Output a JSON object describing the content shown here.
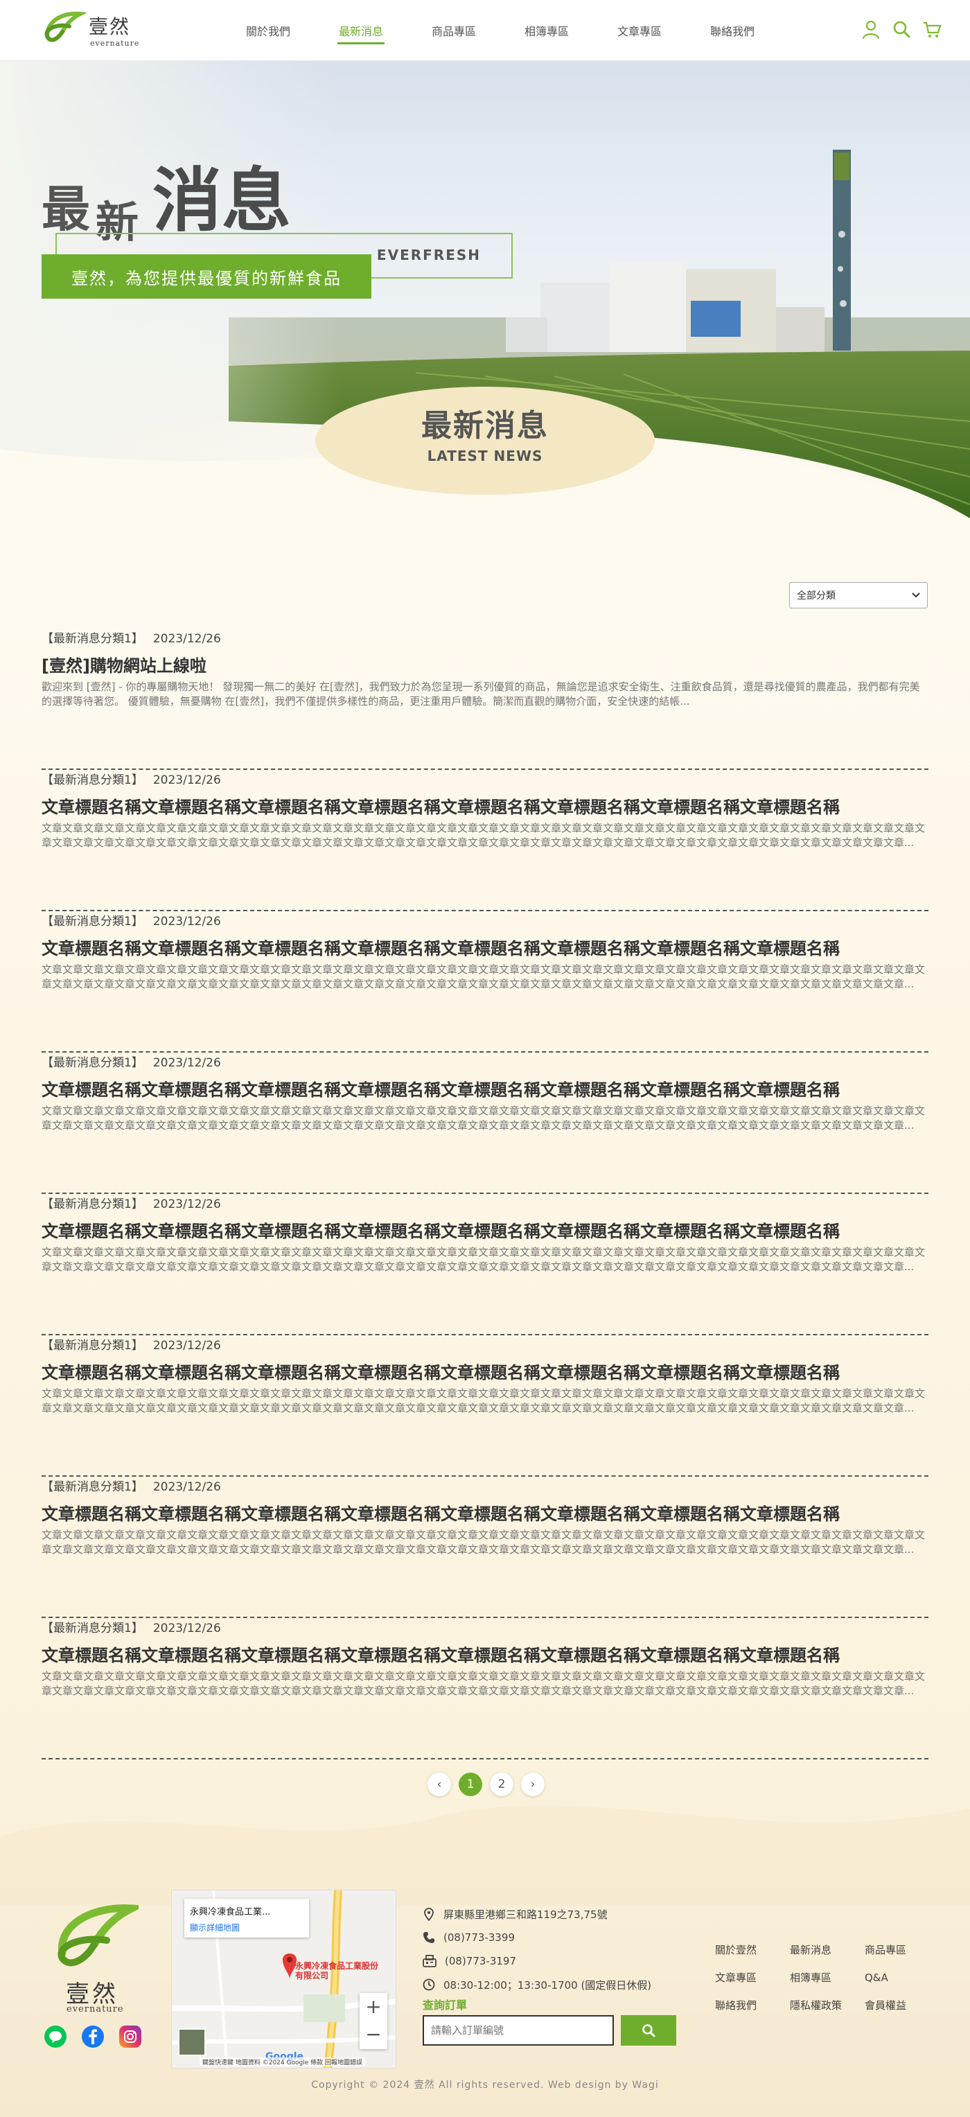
{
  "header": {
    "logo_name": "壹然",
    "logo_sub": "evernature",
    "nav": [
      {
        "label": "關於我們",
        "active": false
      },
      {
        "label": "最新消息",
        "active": true
      },
      {
        "label": "商品專區",
        "active": false
      },
      {
        "label": "相簿專區",
        "active": false
      },
      {
        "label": "文章專區",
        "active": false
      },
      {
        "label": "聯絡我們",
        "active": false
      }
    ],
    "icons": [
      "user-icon",
      "search-icon",
      "cart-icon"
    ]
  },
  "hero": {
    "title_a": "最",
    "title_b": "新",
    "title_c": "消息",
    "box_label": "EVERFRESH",
    "tagline": "壹然，為您提供最優質的新鮮食品",
    "badge_title": "最新消息",
    "badge_sub": "LATEST NEWS"
  },
  "filter": {
    "selected": "全部分類"
  },
  "news": [
    {
      "category": "【最新消息分類1】",
      "date": "2023/12/26",
      "title": "[壹然]購物網站上線啦",
      "desc": "歡迎來到 [壹然] - 你的專屬購物天地！ 發現獨一無二的美好 在[壹然]，我們致力於為您呈現一系列優質的商品，無論您是追求安全衛生、注重飲食品質，還是尋找優質的農產品，我們都有完美的選擇等待著您。 優質體驗，無憂購物 在[壹然]，我們不僅提供多樣性的商品，更注重用戶體驗。簡潔而直觀的購物介面，安全快速的結帳..."
    },
    {
      "category": "【最新消息分類1】",
      "date": "2023/12/26",
      "title": "文章標題名稱文章標題名稱文章標題名稱文章標題名稱文章標題名稱文章標題名稱文章標題名稱文章標題名稱",
      "desc": "文章文章文章文章文章文章文章文章文章文章文章文章文章文章文章文章文章文章文章文章文章文章文章文章文章文章文章文章文章文章文章文章文章文章文章文章文章文章文章文章文章文章文章文章文章文章文章文章文章文章文章文章文章文章文章文章文章文章文章文章文章文章文章文章文章文章文章文章文章文章文章文章文章文章文章文章文章文章文章文章文章文章文章文章..."
    },
    {
      "category": "【最新消息分類1】",
      "date": "2023/12/26",
      "title": "文章標題名稱文章標題名稱文章標題名稱文章標題名稱文章標題名稱文章標題名稱文章標題名稱文章標題名稱",
      "desc": "文章文章文章文章文章文章文章文章文章文章文章文章文章文章文章文章文章文章文章文章文章文章文章文章文章文章文章文章文章文章文章文章文章文章文章文章文章文章文章文章文章文章文章文章文章文章文章文章文章文章文章文章文章文章文章文章文章文章文章文章文章文章文章文章文章文章文章文章文章文章文章文章文章文章文章文章文章文章文章文章文章文章文章文章..."
    },
    {
      "category": "【最新消息分類1】",
      "date": "2023/12/26",
      "title": "文章標題名稱文章標題名稱文章標題名稱文章標題名稱文章標題名稱文章標題名稱文章標題名稱文章標題名稱",
      "desc": "文章文章文章文章文章文章文章文章文章文章文章文章文章文章文章文章文章文章文章文章文章文章文章文章文章文章文章文章文章文章文章文章文章文章文章文章文章文章文章文章文章文章文章文章文章文章文章文章文章文章文章文章文章文章文章文章文章文章文章文章文章文章文章文章文章文章文章文章文章文章文章文章文章文章文章文章文章文章文章文章文章文章文章文章..."
    },
    {
      "category": "【最新消息分類1】",
      "date": "2023/12/26",
      "title": "文章標題名稱文章標題名稱文章標題名稱文章標題名稱文章標題名稱文章標題名稱文章標題名稱文章標題名稱",
      "desc": "文章文章文章文章文章文章文章文章文章文章文章文章文章文章文章文章文章文章文章文章文章文章文章文章文章文章文章文章文章文章文章文章文章文章文章文章文章文章文章文章文章文章文章文章文章文章文章文章文章文章文章文章文章文章文章文章文章文章文章文章文章文章文章文章文章文章文章文章文章文章文章文章文章文章文章文章文章文章文章文章文章文章文章文章..."
    },
    {
      "category": "【最新消息分類1】",
      "date": "2023/12/26",
      "title": "文章標題名稱文章標題名稱文章標題名稱文章標題名稱文章標題名稱文章標題名稱文章標題名稱文章標題名稱",
      "desc": "文章文章文章文章文章文章文章文章文章文章文章文章文章文章文章文章文章文章文章文章文章文章文章文章文章文章文章文章文章文章文章文章文章文章文章文章文章文章文章文章文章文章文章文章文章文章文章文章文章文章文章文章文章文章文章文章文章文章文章文章文章文章文章文章文章文章文章文章文章文章文章文章文章文章文章文章文章文章文章文章文章文章文章文章..."
    },
    {
      "category": "【最新消息分類1】",
      "date": "2023/12/26",
      "title": "文章標題名稱文章標題名稱文章標題名稱文章標題名稱文章標題名稱文章標題名稱文章標題名稱文章標題名稱",
      "desc": "文章文章文章文章文章文章文章文章文章文章文章文章文章文章文章文章文章文章文章文章文章文章文章文章文章文章文章文章文章文章文章文章文章文章文章文章文章文章文章文章文章文章文章文章文章文章文章文章文章文章文章文章文章文章文章文章文章文章文章文章文章文章文章文章文章文章文章文章文章文章文章文章文章文章文章文章文章文章文章文章文章文章文章文章..."
    },
    {
      "category": "【最新消息分類1】",
      "date": "2023/12/26",
      "title": "文章標題名稱文章標題名稱文章標題名稱文章標題名稱文章標題名稱文章標題名稱文章標題名稱文章標題名稱",
      "desc": "文章文章文章文章文章文章文章文章文章文章文章文章文章文章文章文章文章文章文章文章文章文章文章文章文章文章文章文章文章文章文章文章文章文章文章文章文章文章文章文章文章文章文章文章文章文章文章文章文章文章文章文章文章文章文章文章文章文章文章文章文章文章文章文章文章文章文章文章文章文章文章文章文章文章文章文章文章文章文章文章文章文章文章文章..."
    }
  ],
  "pager": {
    "prev": "‹",
    "pages": [
      "1",
      "2"
    ],
    "current": "1",
    "next": "›"
  },
  "footer": {
    "logo_name": "壹然",
    "logo_sub": "evernature",
    "map": {
      "card_title": "永興冷凍食品工業...",
      "card_link": "顯示詳細地圖",
      "pin_label": "永興冷凍食品工業股份有限公司",
      "zoom_in": "+",
      "zoom_out": "−",
      "google": "Google",
      "attribution": "鍵盤快速鍵 地圖資料 ©2024 Google 條款 回報地圖錯誤"
    },
    "address": "屏東縣里港鄉三和路119之73,75號",
    "phone": "(08)773-3399",
    "fax": "(08)773-3197",
    "hours": "08:30-12:00；13:30-1700 (國定假日休假)",
    "query_label": "查詢訂單",
    "query_placeholder": "請輸入訂單編號",
    "links": [
      "關於壹然",
      "最新消息",
      "商品專區",
      "文章專區",
      "相簿專區",
      "Q&A",
      "聯絡我們",
      "隱私權政策",
      "會員權益"
    ],
    "copyright": "Copyright © 2024 壹然 All rights reserved. Web design by Wagi"
  },
  "colors": {
    "accent": "#6fae2c",
    "badge": "#f4e7c4",
    "text": "#333333"
  }
}
